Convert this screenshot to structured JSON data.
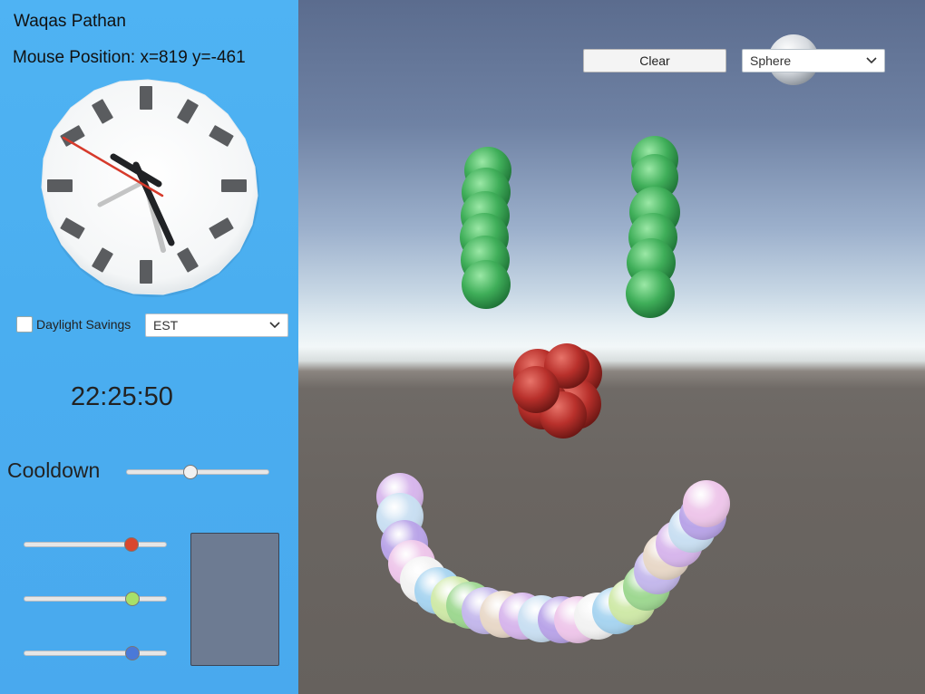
{
  "panel": {
    "author": "Waqas Pathan",
    "mouse_position": "Mouse Position: x=819 y=-461",
    "daylight_savings": {
      "label": "Daylight Savings",
      "checked": false
    },
    "timezone": {
      "selected": "EST"
    },
    "time": "22:25:50",
    "cooldown_label": "Cooldown",
    "cooldown_value": 0.45,
    "color_sliders": [
      {
        "name": "red",
        "color": "#d9472e",
        "value": 0.75
      },
      {
        "name": "green",
        "color": "#a8e06a",
        "value": 0.76
      },
      {
        "name": "blue",
        "color": "#4a79d8",
        "value": 0.76
      }
    ],
    "swatch_color": "#6d7b92"
  },
  "scene": {
    "clear_label": "Clear",
    "shape_selected": "Sphere",
    "eye_color": "#3aa455",
    "nose_color": "#b8302b",
    "smile_colors": [
      "#d7b6ec",
      "#c9dff2",
      "#b9a4e8",
      "#eec6ea",
      "#f2f2f2",
      "#a7d4f0",
      "#cfe9a8",
      "#9ed891",
      "#c4b8ec",
      "#e8d8c8"
    ]
  }
}
